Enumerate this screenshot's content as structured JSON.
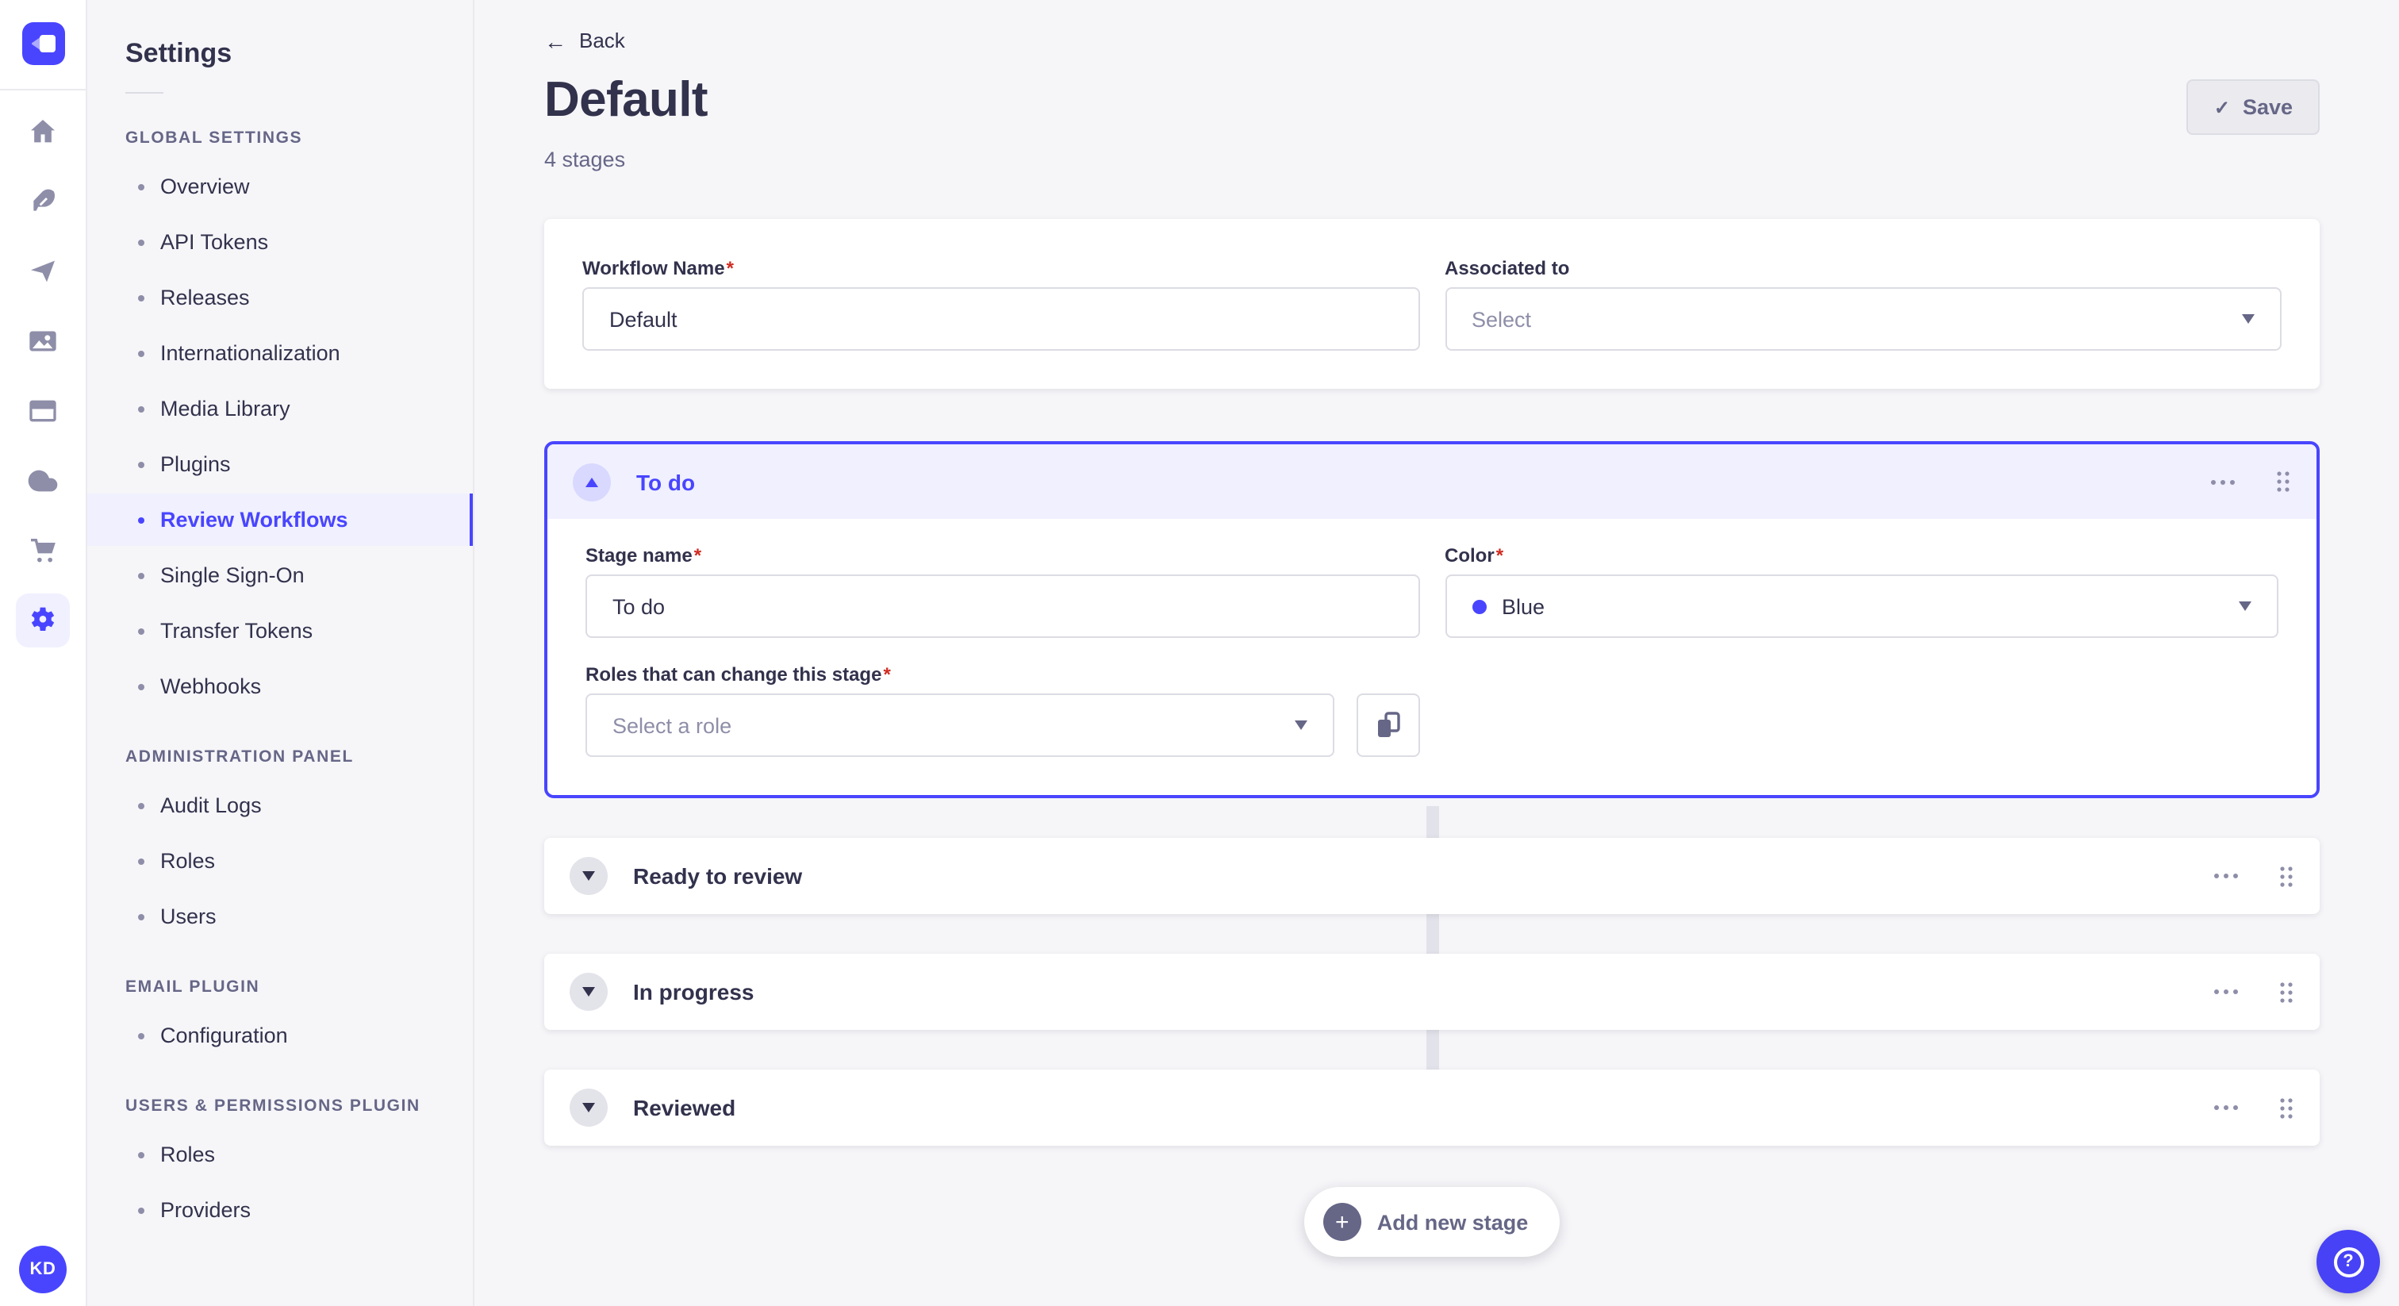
{
  "colors": {
    "accent": "#4945ff",
    "accent_light": "#f0f0ff",
    "background": "#f6f6f9",
    "text": "#32324d",
    "muted": "#666687",
    "border": "#dcdce4",
    "required": "#d02b20",
    "stage_color_hex": "#4945ff"
  },
  "glyphs": {
    "back_arrow": "←",
    "check": "✓",
    "plus": "+",
    "question": "?"
  },
  "rail": {
    "icons": [
      "home-icon",
      "feather-icon",
      "send-icon",
      "media-library-icon",
      "layout-icon",
      "cloud-icon",
      "cart-icon",
      "settings-gear-icon"
    ],
    "active_icon": "settings-gear-icon",
    "avatar_initials": "KD"
  },
  "sidebar": {
    "title": "Settings",
    "sections": [
      {
        "label": "Global Settings",
        "items": [
          {
            "label": "Overview",
            "active": false
          },
          {
            "label": "API Tokens",
            "active": false
          },
          {
            "label": "Releases",
            "active": false
          },
          {
            "label": "Internationalization",
            "active": false
          },
          {
            "label": "Media Library",
            "active": false
          },
          {
            "label": "Plugins",
            "active": false
          },
          {
            "label": "Review Workflows",
            "active": true
          },
          {
            "label": "Single Sign-On",
            "active": false
          },
          {
            "label": "Transfer Tokens",
            "active": false
          },
          {
            "label": "Webhooks",
            "active": false
          }
        ]
      },
      {
        "label": "Administration Panel",
        "items": [
          {
            "label": "Audit Logs",
            "active": false
          },
          {
            "label": "Roles",
            "active": false
          },
          {
            "label": "Users",
            "active": false
          }
        ]
      },
      {
        "label": "Email Plugin",
        "items": [
          {
            "label": "Configuration",
            "active": false
          }
        ]
      },
      {
        "label": "Users & Permissions Plugin",
        "items": [
          {
            "label": "Roles",
            "active": false
          },
          {
            "label": "Providers",
            "active": false
          }
        ]
      }
    ]
  },
  "header": {
    "back_label": "Back",
    "title": "Default",
    "subtitle": "4 stages",
    "save_label": "Save"
  },
  "workflow_form": {
    "name_label": "Workflow Name",
    "name_value": "Default",
    "associated_label": "Associated to",
    "associated_placeholder": "Select"
  },
  "stages": [
    {
      "name": "To do",
      "expanded": true,
      "stage_name_label": "Stage name",
      "stage_name_value": "To do",
      "color_label": "Color",
      "color_value": "Blue",
      "roles_label": "Roles that can change this stage",
      "roles_placeholder": "Select a role"
    },
    {
      "name": "Ready to review",
      "expanded": false
    },
    {
      "name": "In progress",
      "expanded": false
    },
    {
      "name": "Reviewed",
      "expanded": false
    }
  ],
  "footer": {
    "add_stage_label": "Add new stage"
  }
}
